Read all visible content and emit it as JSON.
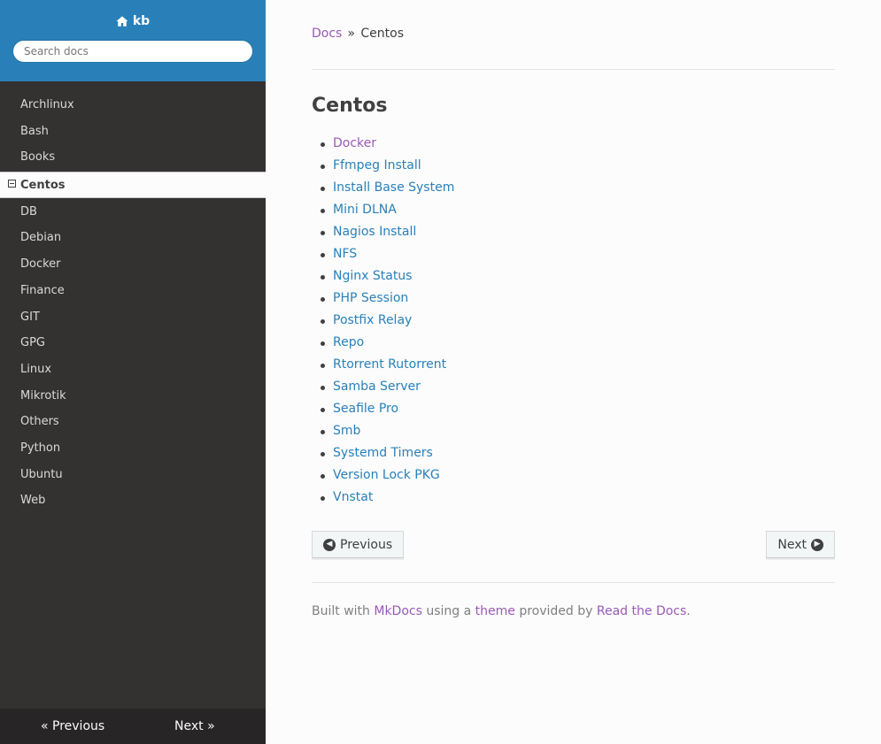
{
  "sidebar": {
    "brand": "kb",
    "search_placeholder": "Search docs",
    "items": [
      {
        "label": "Archlinux"
      },
      {
        "label": "Bash"
      },
      {
        "label": "Books"
      },
      {
        "label": "Centos",
        "current": true
      },
      {
        "label": "DB"
      },
      {
        "label": "Debian"
      },
      {
        "label": "Docker"
      },
      {
        "label": "Finance"
      },
      {
        "label": "GIT"
      },
      {
        "label": "GPG"
      },
      {
        "label": "Linux"
      },
      {
        "label": "Mikrotik"
      },
      {
        "label": "Others"
      },
      {
        "label": "Python"
      },
      {
        "label": "Ubuntu"
      },
      {
        "label": "Web"
      }
    ],
    "footer": {
      "previous": "« Previous",
      "next": "Next »"
    }
  },
  "breadcrumb": {
    "root": "Docs",
    "separator": "»",
    "current": "Centos"
  },
  "main": {
    "title": "Centos",
    "pages": [
      {
        "label": "Docker",
        "visited": true
      },
      {
        "label": "Ffmpeg Install"
      },
      {
        "label": "Install Base System"
      },
      {
        "label": "Mini DLNA"
      },
      {
        "label": "Nagios Install"
      },
      {
        "label": "NFS"
      },
      {
        "label": "Nginx Status"
      },
      {
        "label": "PHP Session"
      },
      {
        "label": "Postfix Relay"
      },
      {
        "label": "Repo"
      },
      {
        "label": "Rtorrent Rutorrent"
      },
      {
        "label": "Samba Server"
      },
      {
        "label": "Seafile Pro"
      },
      {
        "label": "Smb"
      },
      {
        "label": "Systemd Timers"
      },
      {
        "label": "Version Lock PKG"
      },
      {
        "label": "Vnstat"
      }
    ],
    "prev_button": "Previous",
    "next_button": "Next"
  },
  "footer": {
    "built_with": "Built with",
    "mkdocs": "MkDocs",
    "using_a": "using a",
    "theme": "theme",
    "provided_by": "provided by",
    "rtd": "Read the Docs",
    "period": "."
  },
  "colors": {
    "sidebar_header": "#2980b9",
    "sidebar_bg": "#343131",
    "link": "#2980b9",
    "visited": "#9b59b6"
  },
  "icons": {
    "brand": "home-icon",
    "prev": "arrow-circle-left-icon",
    "next": "arrow-circle-right-icon"
  }
}
